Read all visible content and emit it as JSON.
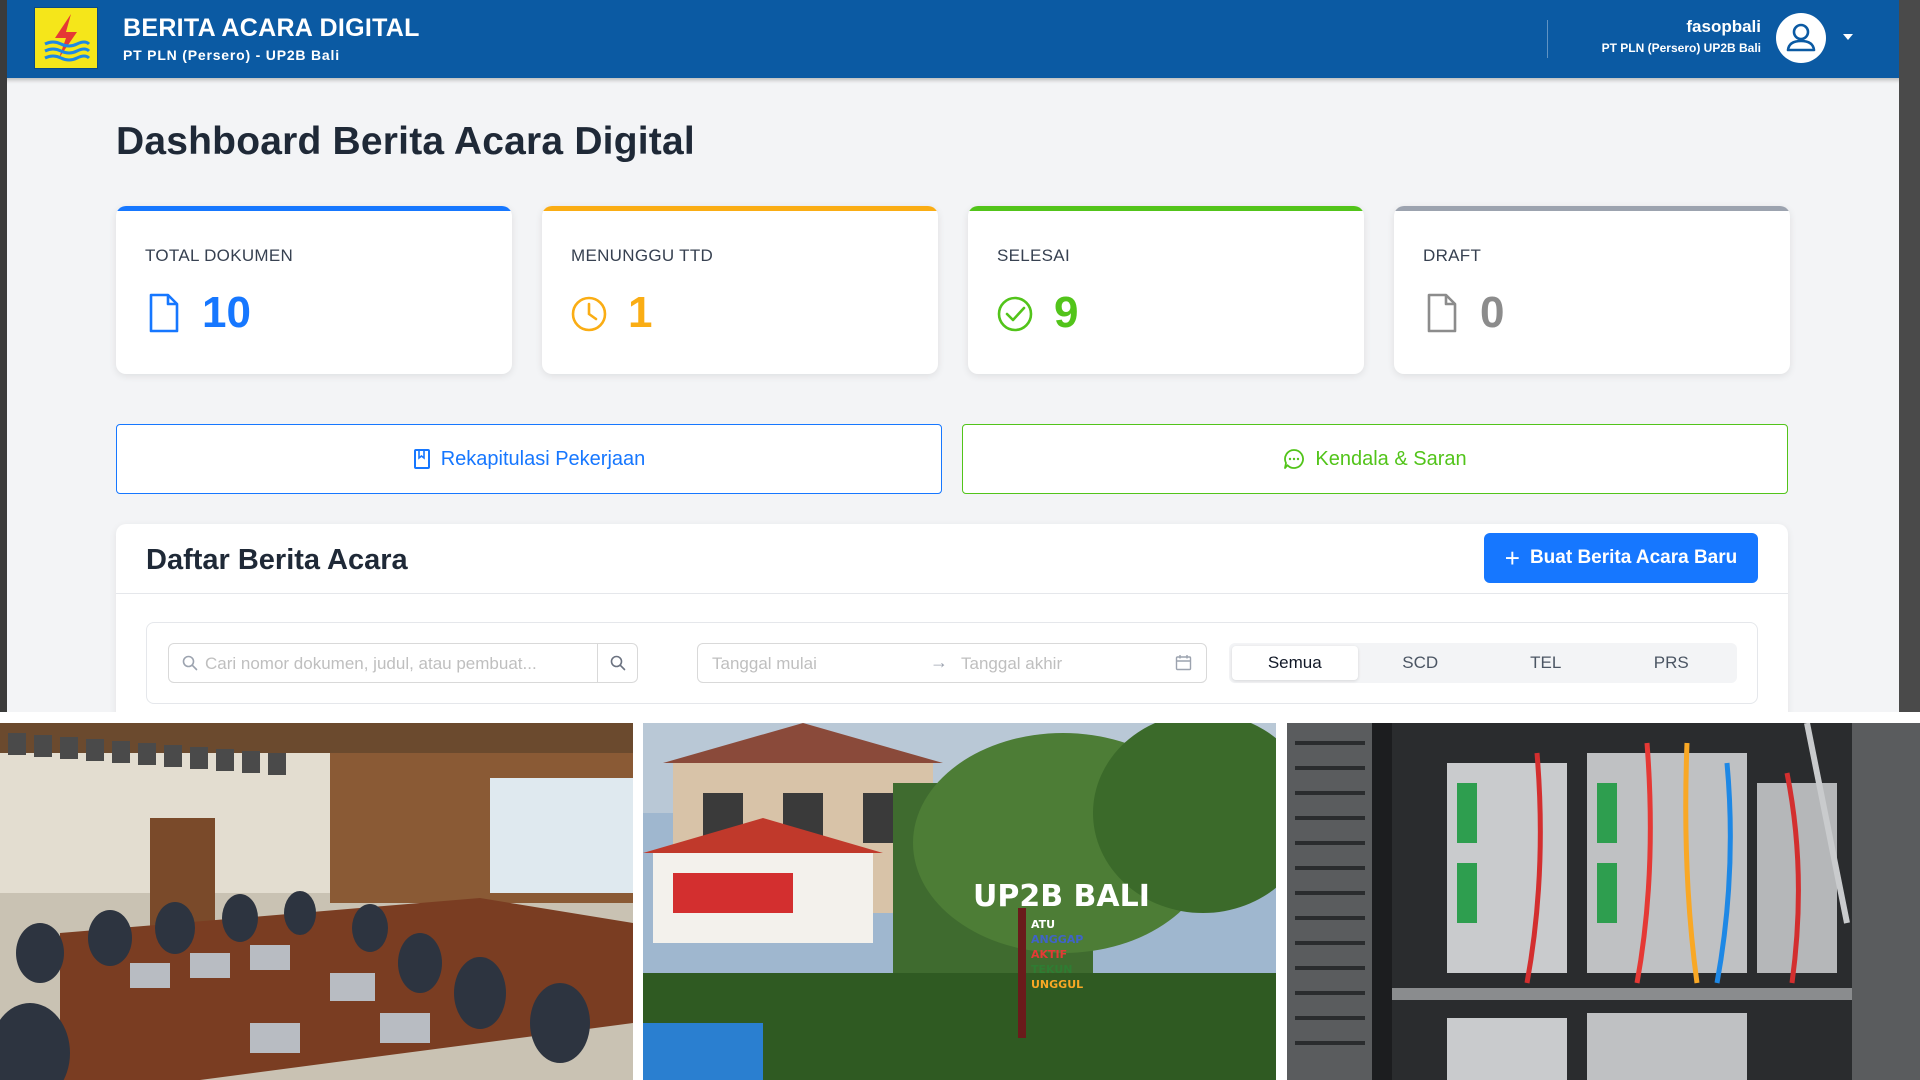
{
  "header": {
    "app_title": "BERITA ACARA DIGITAL",
    "app_subtitle": "PT PLN (Persero) - UP2B Bali",
    "user_name": "fasopbali",
    "user_org": "PT PLN (Persero) UP2B Bali",
    "logo_icon": "pln-logo-icon",
    "avatar_icon": "user-avatar-icon"
  },
  "page": {
    "title": "Dashboard Berita Acara Digital"
  },
  "stats": [
    {
      "label": "TOTAL DOKUMEN",
      "value": "10",
      "color": "#1677ff",
      "icon": "document-icon"
    },
    {
      "label": "MENUNGGU TTD",
      "value": "1",
      "color": "#faad14",
      "icon": "clock-icon"
    },
    {
      "label": "SELESAI",
      "value": "9",
      "color": "#52c41a",
      "icon": "check-circle-icon"
    },
    {
      "label": "DRAFT",
      "value": "0",
      "color": "#8c8c8c",
      "icon": "document-icon"
    }
  ],
  "actions": {
    "recap_label": "Rekapitulasi Pekerjaan",
    "recap_color": "#1677ff",
    "feedback_label": "Kendala & Saran",
    "feedback_color": "#52c41a"
  },
  "list": {
    "title": "Daftar Berita Acara",
    "new_button_label": "Buat Berita Acara Baru",
    "search_placeholder": "Cari nomor dokumen, judul, atau pembuat...",
    "date_start_placeholder": "Tanggal mulai",
    "date_end_placeholder": "Tanggal akhir",
    "filters": [
      "Semua",
      "SCD",
      "TEL",
      "PRS"
    ],
    "active_filter": "Semua"
  },
  "photos": {
    "sign_text": "UP2B BALI",
    "motto": [
      "ATU",
      "ANGGAP",
      "AKTIF",
      "TEKUN",
      "UNGGUL"
    ]
  }
}
